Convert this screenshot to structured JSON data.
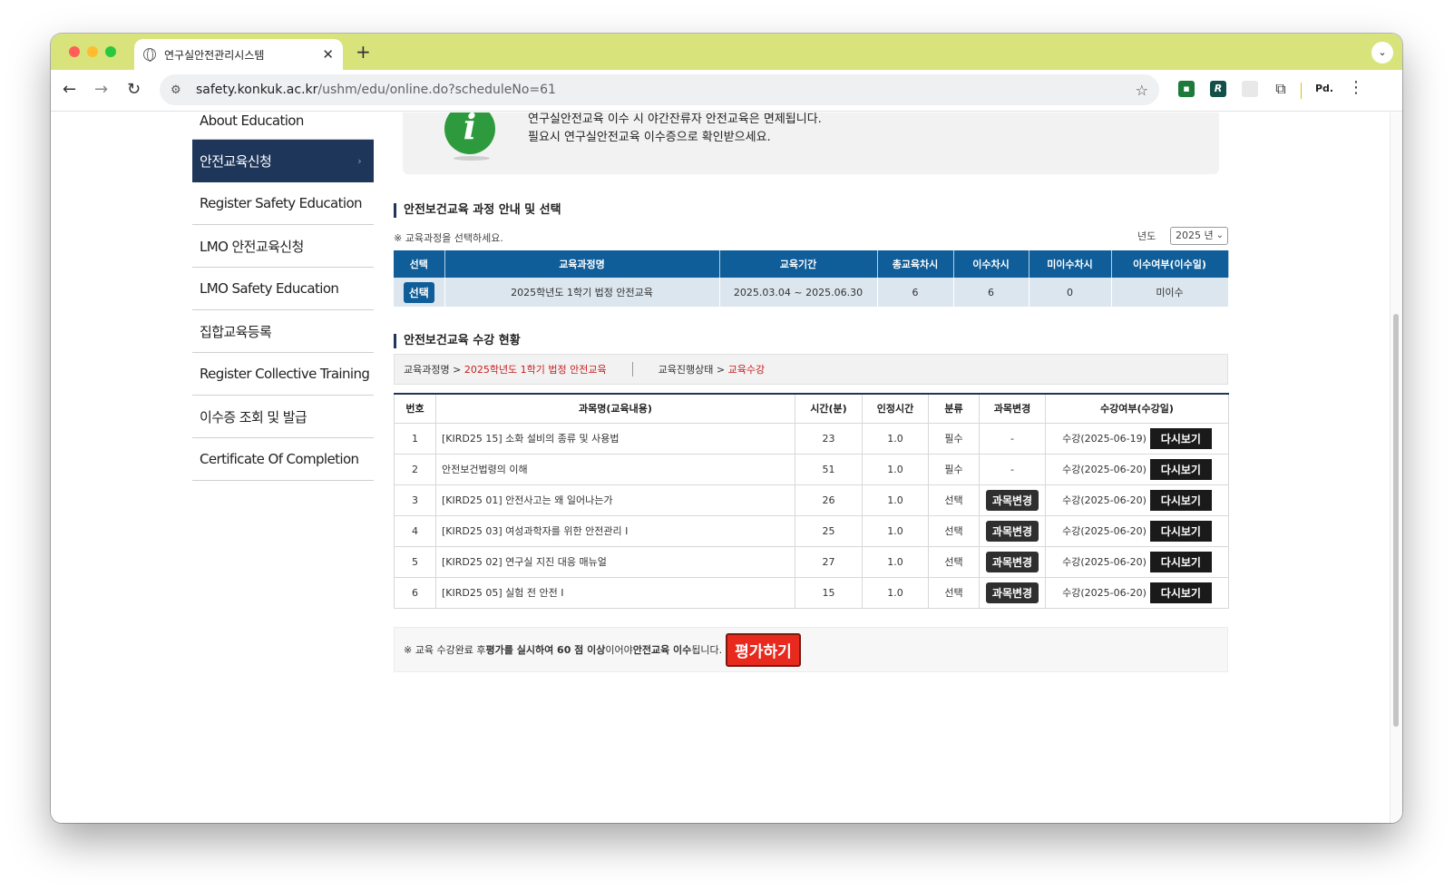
{
  "browser": {
    "tab_title": "연구실안전관리시스템",
    "url_host": "safety.konkuk.ac.kr",
    "url_path": "/ushm/edu/online.do?scheduleNo=61",
    "ext_label": "Pd."
  },
  "sidebar": {
    "items": [
      {
        "label": "About Education"
      },
      {
        "label": "안전교육신청"
      },
      {
        "label": "Register Safety Education"
      },
      {
        "label": "LMO 안전교육신청"
      },
      {
        "label": "LMO Safety Education"
      },
      {
        "label": "집합교육등록"
      },
      {
        "label": "Register Collective Training"
      },
      {
        "label": "이수증 조회 및 발급"
      },
      {
        "label": "Certificate Of Completion"
      }
    ]
  },
  "notice": {
    "line1": "연구실안전교육 이수 시 야간잔류자 안전교육은 면제됩니다.",
    "line2": "필요시 연구실안전교육 이수증으로 확인받으세요."
  },
  "course_section": {
    "title": "안전보건교육 과정 안내 및 선택",
    "hint": "※ 교육과정을 선택하세요.",
    "year_label": "년도",
    "year_value": "2025 년",
    "headers": [
      "선택",
      "교육과정명",
      "교육기간",
      "총교육차시",
      "이수차시",
      "미이수차시",
      "이수여부(이수일)"
    ],
    "row": {
      "select_label": "선택",
      "name": "2025학년도 1학기 법정 안전교육",
      "period": "2025.03.04 ~ 2025.06.30",
      "total": "6",
      "done": "6",
      "undone": "0",
      "status": "미이수"
    }
  },
  "progress_section": {
    "title": "안전보건교육 수강 현황",
    "course_label": "교육과정명 > ",
    "course_value": "2025학년도 1학기 법정 안전교육",
    "state_label": "교육진행상태 > ",
    "state_value": "교육수강",
    "headers": [
      "번호",
      "과목명(교육내용)",
      "시간(분)",
      "인정시간",
      "분류",
      "과목변경",
      "수강여부(수강일)"
    ],
    "rows": [
      {
        "no": "1",
        "title": "[KIRD25 15] 소화 설비의 종류 및 사용법",
        "minutes": "23",
        "credit": "1.0",
        "type": "필수",
        "change": "-",
        "status": "수강(2025-06-19)"
      },
      {
        "no": "2",
        "title": "안전보건법령의 이해",
        "minutes": "51",
        "credit": "1.0",
        "type": "필수",
        "change": "-",
        "status": "수강(2025-06-20)"
      },
      {
        "no": "3",
        "title": "[KIRD25 01] 안전사고는 왜 일어나는가",
        "minutes": "26",
        "credit": "1.0",
        "type": "선택",
        "change": "과목변경",
        "status": "수강(2025-06-20)"
      },
      {
        "no": "4",
        "title": "[KIRD25 03] 여성과학자를 위한 안전관리 I",
        "minutes": "25",
        "credit": "1.0",
        "type": "선택",
        "change": "과목변경",
        "status": "수강(2025-06-20)"
      },
      {
        "no": "5",
        "title": "[KIRD25 02] 연구실 지진 대응 매뉴얼",
        "minutes": "27",
        "credit": "1.0",
        "type": "선택",
        "change": "과목변경",
        "status": "수강(2025-06-20)"
      },
      {
        "no": "6",
        "title": "[KIRD25 05] 실험 전 안전 Ⅰ",
        "minutes": "15",
        "credit": "1.0",
        "type": "선택",
        "change": "과목변경",
        "status": "수강(2025-06-20)"
      }
    ],
    "rewatch_label": "다시보기"
  },
  "evaluation": {
    "text_a": "※ 교육 수강완료 후 ",
    "text_b": "평가를 실시하여 60 점 이상",
    "text_c": "이어야 ",
    "text_d": "안전교육 이수",
    "text_e": "됩니다.",
    "button": "평가하기"
  }
}
